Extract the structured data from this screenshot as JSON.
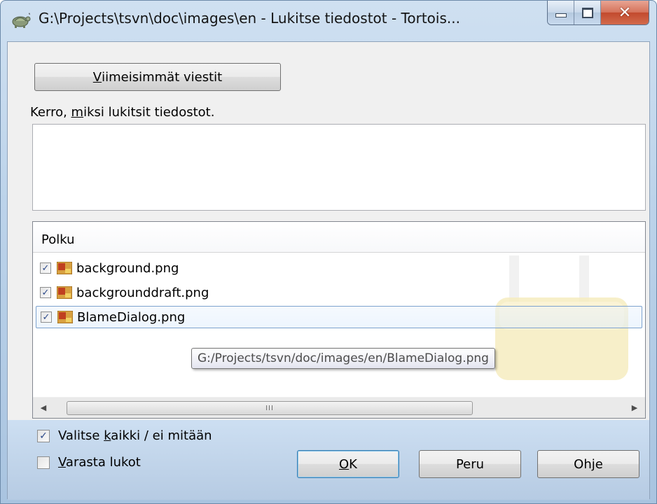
{
  "window": {
    "title": "G:\\Projects\\tsvn\\doc\\images\\en - Lukitse tiedostot - Tortois..."
  },
  "recent_messages_button": {
    "label_first": "V",
    "label_rest": "iimeisimmät viestit"
  },
  "message_prompt": {
    "before": "Kerro, ",
    "accel": "m",
    "after": "iksi lukitsit tiedostot."
  },
  "message_value": "",
  "file_list": {
    "column_header": "Polku",
    "rows": [
      {
        "name": "background.png",
        "checked": true
      },
      {
        "name": "backgrounddraft.png",
        "checked": true
      },
      {
        "name": "BlameDialog.png",
        "checked": true
      }
    ],
    "tooltip": "G:/Projects/tsvn/doc/images/en/BlameDialog.png",
    "scroll_thumb_grip": "III"
  },
  "select_all_checkbox": {
    "checked": true,
    "before": "Valitse ",
    "accel": "k",
    "after": "aikki / ei mitään"
  },
  "steal_locks_checkbox": {
    "checked": false,
    "accel": "V",
    "after": "arasta lukot"
  },
  "buttons": {
    "ok": {
      "accel": "O",
      "rest": "K"
    },
    "cancel": "Peru",
    "help": "Ohje"
  },
  "colors": {
    "title_bar": "#bcd3ea",
    "close_button": "#c24a2e",
    "focus_border": "#7da2ce"
  },
  "icons": {
    "app": "tortoise-icon",
    "file": "png-file-icon",
    "minimize": "minimize-icon",
    "maximize": "maximize-icon",
    "close": "close-icon",
    "scroll_left": "chevron-left-icon",
    "scroll_right": "chevron-right-icon"
  }
}
